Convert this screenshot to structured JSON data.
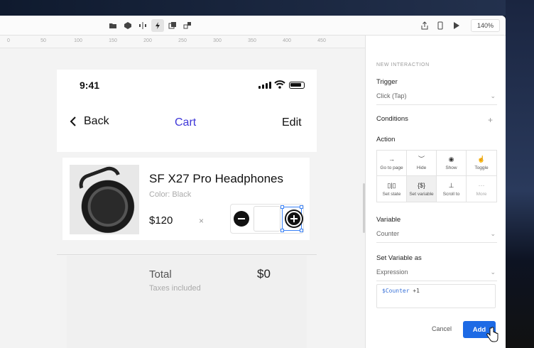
{
  "toolbar": {
    "zoom": "140%",
    "center_icons": [
      "folder-icon",
      "component-icon",
      "distribute-icon",
      "interaction-icon",
      "layers-icon",
      "group-icon"
    ],
    "right_icons": [
      "share-icon",
      "device-preview-icon",
      "play-icon"
    ]
  },
  "ruler": {
    "ticks": [
      "0",
      "50",
      "100",
      "150",
      "200",
      "250",
      "300",
      "350",
      "400",
      "450"
    ]
  },
  "phone": {
    "time": "9:41",
    "nav": {
      "back": "Back",
      "title": "Cart",
      "edit": "Edit"
    },
    "product": {
      "name": "SF X27 Pro Headphones",
      "color": "Color: Black",
      "price": "$120",
      "times": "×"
    },
    "summary": {
      "total_label": "Total",
      "taxes": "Taxes included",
      "amount": "$0"
    }
  },
  "panel": {
    "header": "NEW INTERACTION",
    "trigger": {
      "label": "Trigger",
      "value": "Click (Tap)"
    },
    "conditions": {
      "label": "Conditions"
    },
    "action": {
      "label": "Action",
      "items": [
        {
          "label": "Go to page",
          "icon": "→"
        },
        {
          "label": "Hide",
          "icon": "︶"
        },
        {
          "label": "Show",
          "icon": "◉"
        },
        {
          "label": "Toggle",
          "icon": "☝"
        },
        {
          "label": "Set state",
          "icon": "▯|▯"
        },
        {
          "label": "Set variable",
          "icon": "{$}"
        },
        {
          "label": "Scroll to",
          "icon": "⊥"
        },
        {
          "label": "More",
          "icon": "···"
        }
      ]
    },
    "variable": {
      "label": "Variable",
      "value": "Counter"
    },
    "set_variable": {
      "label": "Set Variable as",
      "value": "Expression"
    },
    "expression": {
      "var": "$Counter",
      "rest": " +1"
    },
    "buttons": {
      "cancel": "Cancel",
      "add": "Add"
    }
  },
  "colors": {
    "accent": "#1d6ae5",
    "cart_title": "#3f37d8",
    "selection": "#3b82f6"
  }
}
